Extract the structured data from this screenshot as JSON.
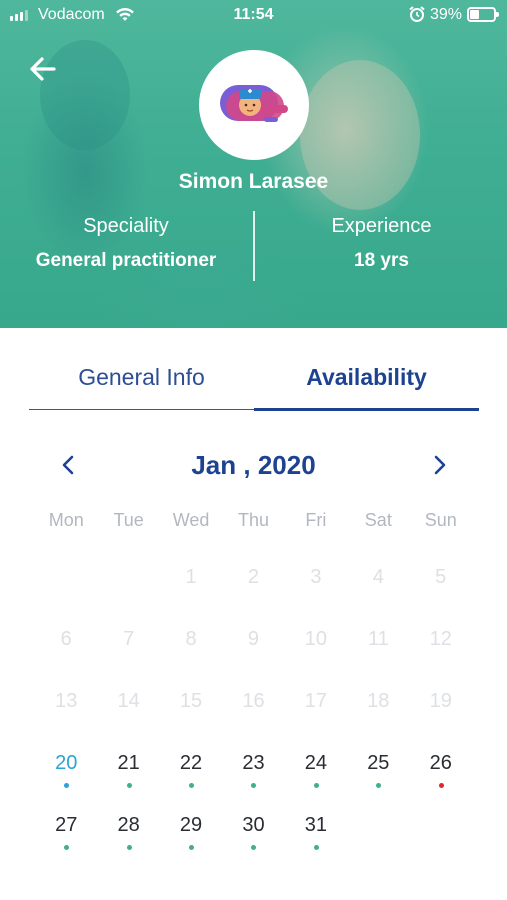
{
  "status_bar": {
    "carrier": "Vodacom",
    "time": "11:54",
    "battery": "39%"
  },
  "doctor": {
    "name": "Simon Larasee",
    "speciality_label": "Speciality",
    "speciality_value": "General practitioner",
    "experience_label": "Experience",
    "experience_value": "18 yrs"
  },
  "tabs": {
    "general": "General Info",
    "availability": "Availability",
    "selected": "Availability"
  },
  "calendar": {
    "month": "Jan , 2020",
    "weekdays": [
      "Mon",
      "Tue",
      "Wed",
      "Thu",
      "Fri",
      "Sat",
      "Sun"
    ],
    "weeks": [
      [
        null,
        null,
        {
          "d": "1",
          "state": "disabled"
        },
        {
          "d": "2",
          "state": "disabled"
        },
        {
          "d": "3",
          "state": "disabled"
        },
        {
          "d": "4",
          "state": "disabled"
        },
        {
          "d": "5",
          "state": "disabled"
        }
      ],
      [
        {
          "d": "6",
          "state": "disabled"
        },
        {
          "d": "7",
          "state": "disabled"
        },
        {
          "d": "8",
          "state": "disabled"
        },
        {
          "d": "9",
          "state": "disabled"
        },
        {
          "d": "10",
          "state": "disabled"
        },
        {
          "d": "11",
          "state": "disabled"
        },
        {
          "d": "12",
          "state": "disabled"
        }
      ],
      [
        {
          "d": "13",
          "state": "disabled"
        },
        {
          "d": "14",
          "state": "disabled"
        },
        {
          "d": "15",
          "state": "disabled"
        },
        {
          "d": "16",
          "state": "disabled"
        },
        {
          "d": "17",
          "state": "disabled"
        },
        {
          "d": "18",
          "state": "disabled"
        },
        {
          "d": "19",
          "state": "disabled"
        }
      ],
      [
        {
          "d": "20",
          "state": "today",
          "dot": "#2aa3d6"
        },
        {
          "d": "21",
          "state": "active",
          "dot": "#3fb08f"
        },
        {
          "d": "22",
          "state": "active",
          "dot": "#3fb08f"
        },
        {
          "d": "23",
          "state": "active",
          "dot": "#3fb08f"
        },
        {
          "d": "24",
          "state": "active",
          "dot": "#3fb08f"
        },
        {
          "d": "25",
          "state": "active",
          "dot": "#3fb08f"
        },
        {
          "d": "26",
          "state": "active",
          "dot": "#e0262f"
        }
      ],
      [
        {
          "d": "27",
          "state": "active",
          "dot": "#3fb08f"
        },
        {
          "d": "28",
          "state": "active",
          "dot": "#3fb08f"
        },
        {
          "d": "29",
          "state": "active",
          "dot": "#3fb08f"
        },
        {
          "d": "30",
          "state": "active",
          "dot": "#3fb08f"
        },
        {
          "d": "31",
          "state": "active",
          "dot": "#3fb08f"
        },
        null,
        null
      ]
    ]
  },
  "colors": {
    "hero": "#3fae93",
    "primary": "#1e4292",
    "today": "#2aa3d6",
    "available_dot": "#3fb08f",
    "unavailable_dot": "#e0262f",
    "disabled_text": "#dde0e4"
  },
  "icons": {
    "back": "arrow-left-icon",
    "prev": "chevron-left-icon",
    "next": "chevron-right-icon",
    "avatar": "doctor-avatar-icon",
    "wifi": "wifi-icon",
    "alarm": "alarm-icon",
    "battery": "battery-icon",
    "signal": "signal-icon"
  }
}
